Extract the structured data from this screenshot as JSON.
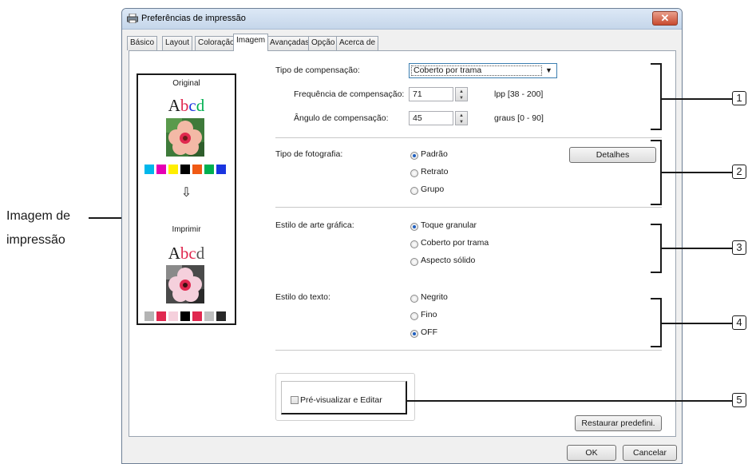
{
  "window": {
    "title": "Preferências de impressão",
    "close_label": "✕"
  },
  "tabs": [
    "Básico",
    "Layout",
    "Coloração",
    "Imagem",
    "Avançadas",
    "Opção",
    "Acerca de"
  ],
  "preview": {
    "original_label": "Original",
    "print_label": "Imprimir",
    "sample_text": "Abcd",
    "arrow": "⇩",
    "original_swatches": [
      "#00b7eb",
      "#e600b4",
      "#ffee00",
      "#000000",
      "#f05a14",
      "#00b050",
      "#1a35e0"
    ],
    "print_swatches": [
      "#b4b4b4",
      "#e0284f",
      "#f5d0dc",
      "#000000",
      "#e0284f",
      "#c0c0c0",
      "#282828"
    ]
  },
  "compensation": {
    "type_label": "Tipo de compensação:",
    "type_value": "Coberto por trama",
    "freq_label": "Frequência de compensação:",
    "freq_value": "71",
    "freq_unit": "lpp [38 - 200]",
    "angle_label": "Ângulo de compensação:",
    "angle_value": "45",
    "angle_unit": "graus [0 - 90]"
  },
  "photo": {
    "label": "Tipo de fotografia:",
    "options": [
      "Padrão",
      "Retrato",
      "Grupo"
    ],
    "selected": "Padrão",
    "details_button": "Detalhes"
  },
  "graphic": {
    "label": "Estilo de arte gráfica:",
    "options": [
      "Toque granular",
      "Coberto por trama",
      "Aspecto sólido"
    ],
    "selected": "Toque granular"
  },
  "text_style": {
    "label": "Estilo do texto:",
    "options": [
      "Negrito",
      "Fino",
      "OFF"
    ],
    "selected": "OFF"
  },
  "preview_edit": {
    "label": "Pré-visualizar e Editar",
    "checked": false
  },
  "buttons": {
    "restore": "Restaurar predefini.",
    "ok": "OK",
    "cancel": "Cancelar"
  },
  "annotation": {
    "line1": "Imagem de",
    "line2": "impressão"
  },
  "callouts": [
    "1",
    "2",
    "3",
    "4",
    "5"
  ]
}
